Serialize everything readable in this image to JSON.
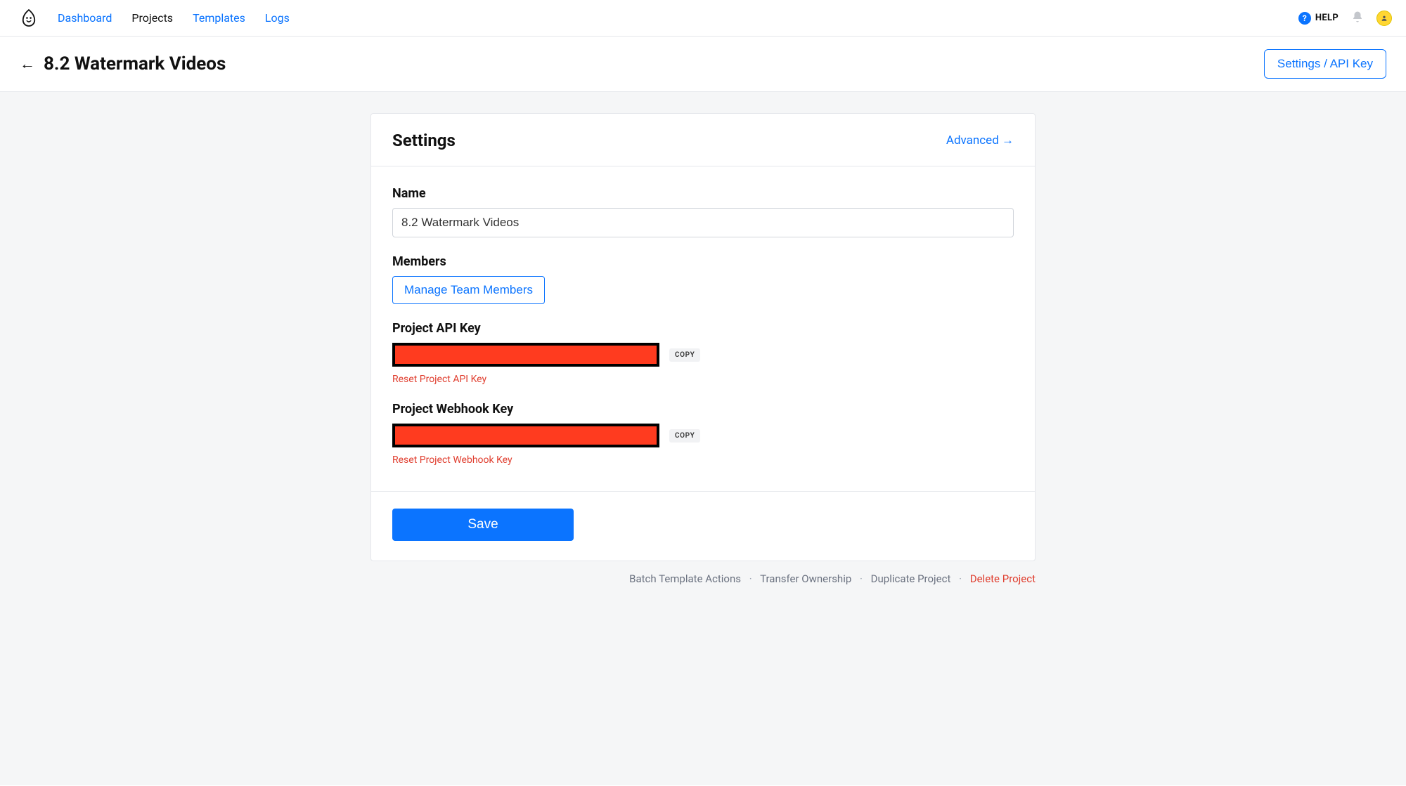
{
  "nav": {
    "links": [
      "Dashboard",
      "Projects",
      "Templates",
      "Logs"
    ],
    "active_index": 1,
    "help_label": "HELP"
  },
  "subheader": {
    "title": "8.2 Watermark Videos",
    "settings_button": "Settings / API Key"
  },
  "card": {
    "title": "Settings",
    "advanced_link": "Advanced →",
    "name_label": "Name",
    "name_value": "8.2 Watermark Videos",
    "members_label": "Members",
    "manage_members_button": "Manage Team Members",
    "api_key_label": "Project API Key",
    "api_key_copy": "COPY",
    "api_key_reset": "Reset Project API Key",
    "webhook_key_label": "Project Webhook Key",
    "webhook_key_copy": "COPY",
    "webhook_key_reset": "Reset Project Webhook Key",
    "save_button": "Save"
  },
  "footer": {
    "batch": "Batch Template Actions",
    "transfer": "Transfer Ownership",
    "duplicate": "Duplicate Project",
    "delete": "Delete Project"
  }
}
